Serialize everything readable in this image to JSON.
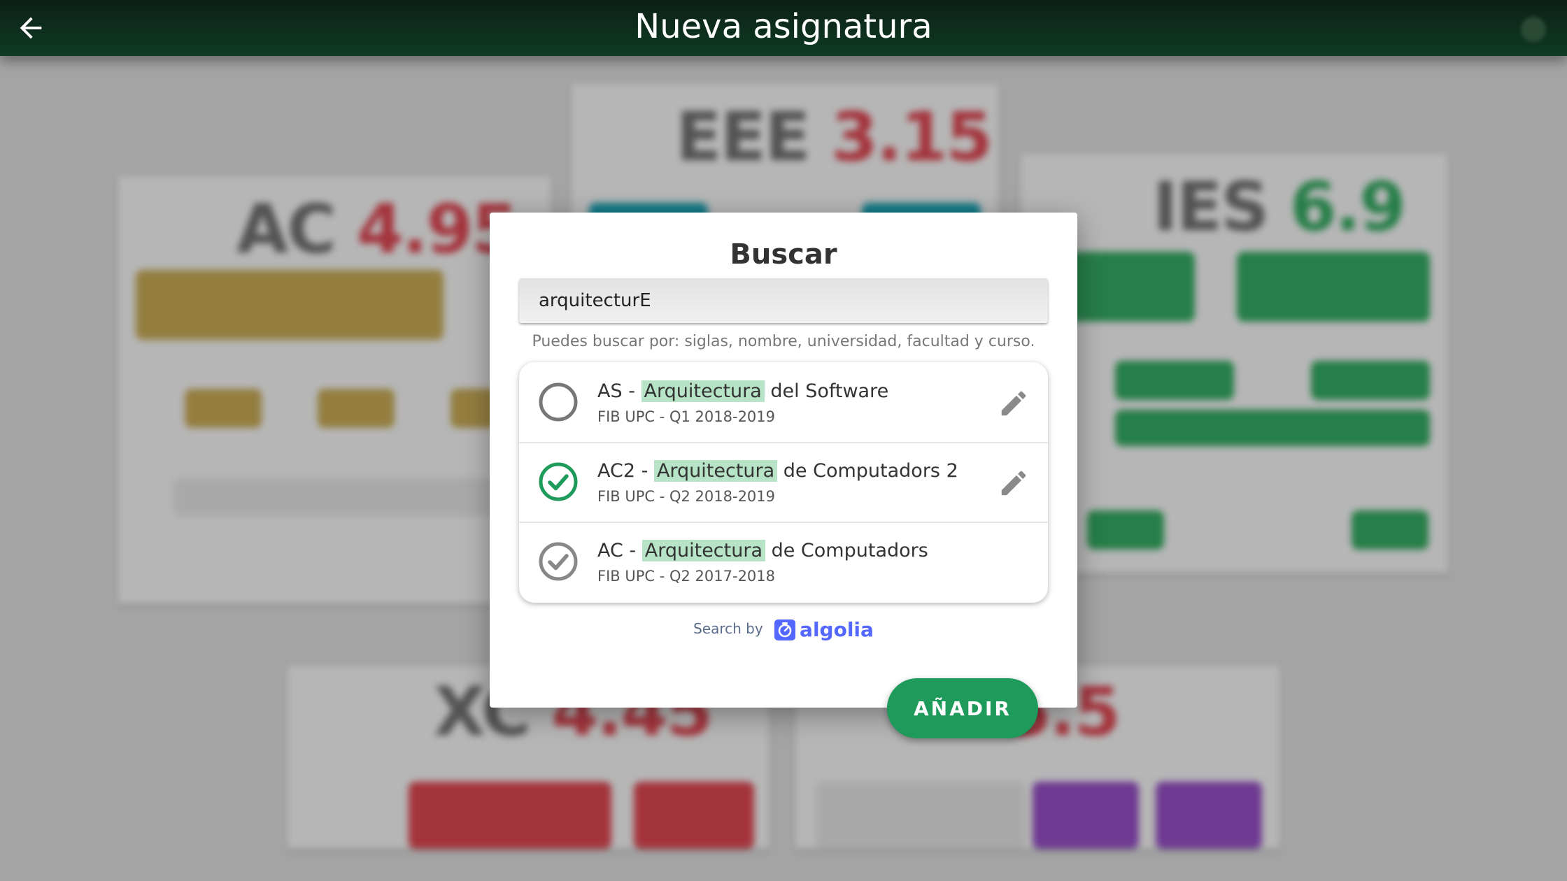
{
  "appbar": {
    "title": "Nueva asignatura"
  },
  "background_cards": [
    {
      "code": "AC",
      "grade": "4.95"
    },
    {
      "code": "EEE",
      "grade": "3.15"
    },
    {
      "code": "IES",
      "grade": "6.9"
    },
    {
      "code": "XC",
      "grade": "4.45"
    },
    {
      "code": "",
      "grade": "5.5"
    }
  ],
  "dialog": {
    "title": "Buscar",
    "search": {
      "value": "arquitecturE",
      "placeholder": ""
    },
    "hint": "Puedes buscar por: siglas, nombre, universidad, facultad y curso.",
    "results": [
      {
        "code": "AS - ",
        "match": "Arquitectura",
        "rest": " del Software",
        "meta": "FIB UPC - Q1 2018-2019",
        "status": "unselected",
        "editable": true
      },
      {
        "code": "AC2 - ",
        "match": "Arquitectura",
        "rest": " de Computadors 2",
        "meta": "FIB UPC - Q2 2018-2019",
        "status": "selected",
        "editable": true
      },
      {
        "code": "AC - ",
        "match": "Arquitectura",
        "rest": " de Computadors",
        "meta": "FIB UPC - Q2 2017-2018",
        "status": "added",
        "editable": false
      }
    ],
    "search_by": "Search by",
    "search_brand": "algolia"
  },
  "add_button": {
    "label": "AÑADIR"
  },
  "colors": {
    "accent": "#1e9a5a",
    "highlight": "#b7e3c6",
    "appbar": "#0f3a24"
  },
  "icons": {
    "back": "arrow-left-icon",
    "edit": "pencil-icon",
    "selected": "check-circle-icon",
    "unselected": "empty-circle-icon"
  }
}
